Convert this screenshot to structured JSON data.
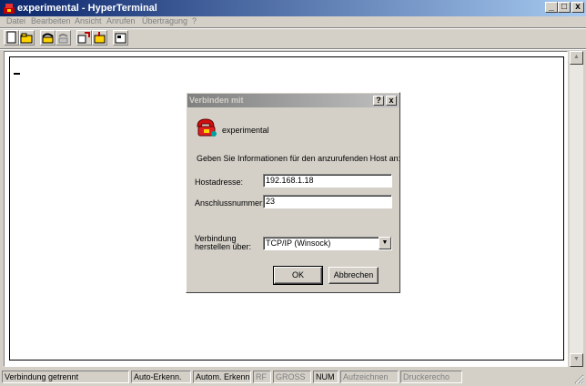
{
  "window": {
    "title": "experimental - HyperTerminal",
    "minimize": "_",
    "maximize": "□",
    "close": "x"
  },
  "menu": [
    "Datei",
    "Bearbeiten",
    "Ansicht",
    "Anrufen",
    "Übertragung",
    "?"
  ],
  "toolbar": {
    "buttons": [
      "new-icon",
      "open-icon",
      "connect-icon",
      "disconnect-icon",
      "send-icon",
      "receive-icon",
      "properties-icon"
    ]
  },
  "terminal": {
    "cursor": "_"
  },
  "dialog": {
    "title": "Verbinden mit",
    "help": "?",
    "close": "x",
    "connection_name": "experimental",
    "instruction": "Geben Sie Informationen für den anzurufenden Host an:",
    "host_label": "Hostadresse:",
    "host_value": "192.168.1.18",
    "port_label": "Anschlussnummer:",
    "port_value": "23",
    "via_label_line1": "Verbindung",
    "via_label_line2": "herstellen über:",
    "via_value": "TCP/IP (Winsock)",
    "ok": "OK",
    "cancel": "Abbrechen"
  },
  "statusbar": {
    "status": "Verbindung getrennt",
    "auto_detect": "Auto-Erkenn.",
    "auto_detect2": "Autom. Erkenn.",
    "rf": "RF",
    "caps": "GROSS",
    "num": "NUM",
    "capture": "Aufzeichnen",
    "print_echo": "Druckerecho"
  },
  "colors": {
    "titlebar_start": "#0a246a",
    "titlebar_end": "#a6caf0",
    "inactive_title_start": "#808080",
    "face": "#d4d0c8"
  }
}
